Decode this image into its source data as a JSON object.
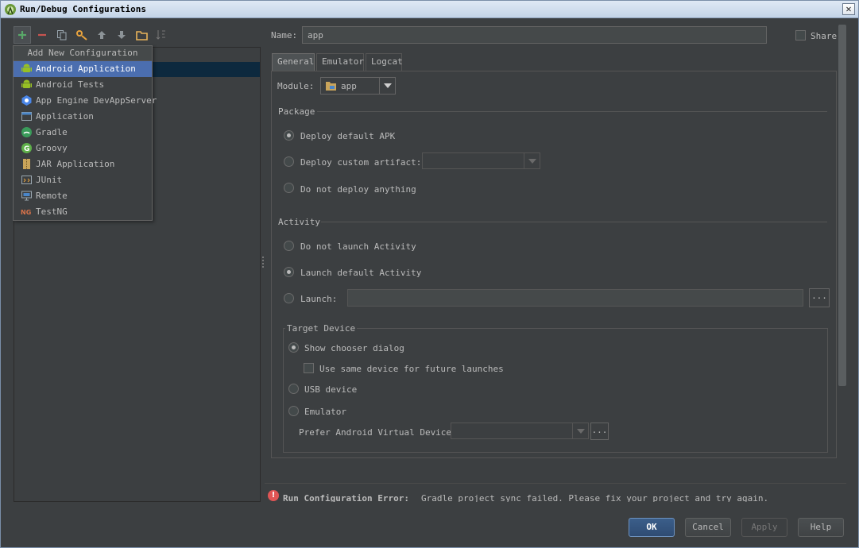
{
  "window": {
    "title": "Run/Debug Configurations",
    "close_glyph": "✕"
  },
  "toolbar": {
    "buttons": [
      "add-icon",
      "remove-icon",
      "copy-icon",
      "edit-defaults-icon",
      "move-up-icon",
      "move-down-icon",
      "folder-icon",
      "sort-icon"
    ]
  },
  "popup": {
    "header": "Add New Configuration",
    "items": [
      {
        "label": "Android Application",
        "icon": "android-icon"
      },
      {
        "label": "Android Tests",
        "icon": "android-icon"
      },
      {
        "label": "App Engine DevAppServer",
        "icon": "app-engine-icon"
      },
      {
        "label": "Application",
        "icon": "application-icon"
      },
      {
        "label": "Gradle",
        "icon": "gradle-icon"
      },
      {
        "label": "Groovy",
        "icon": "groovy-icon"
      },
      {
        "label": "JAR Application",
        "icon": "jar-icon"
      },
      {
        "label": "JUnit",
        "icon": "junit-icon"
      },
      {
        "label": "Remote",
        "icon": "remote-icon"
      },
      {
        "label": "TestNG",
        "icon": "testng-icon"
      }
    ]
  },
  "form": {
    "name_label": "Name:",
    "name_value": "app",
    "share_label": "Share",
    "tabs": [
      "General",
      "Emulator",
      "Logcat"
    ],
    "module_label": "Module:",
    "module_value": "app",
    "package_title": "Package",
    "package_options": [
      "Deploy default APK",
      "Deploy custom artifact:",
      "Do not deploy anything"
    ],
    "activity_title": "Activity",
    "activity_options": [
      "Do not launch Activity",
      "Launch default Activity",
      "Launch:"
    ],
    "dots": "...",
    "target_title": "Target Device",
    "target_options": [
      "Show chooser dialog",
      "USB device",
      "Emulator"
    ],
    "same_device_label": "Use same device for future launches",
    "prefer_avd_label": "Prefer Android Virtual Device:"
  },
  "error": {
    "bold": "Run Configuration Error:",
    "message": "Gradle project sync failed. Please fix your project and try again."
  },
  "buttons": {
    "ok": "OK",
    "cancel": "Cancel",
    "apply": "Apply",
    "help": "Help"
  },
  "colors": {
    "background": "#3c3f41",
    "selection": "#4b6eaf",
    "error": "#e05555",
    "default_button": "#2f4c73"
  }
}
